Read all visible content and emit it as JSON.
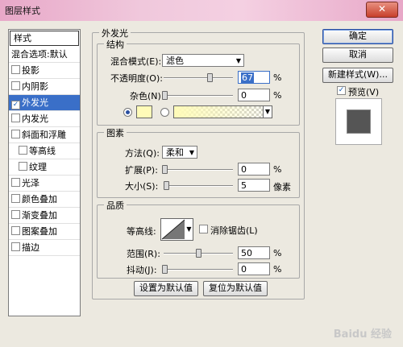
{
  "window": {
    "title": "图层样式",
    "close_glyph": "✕"
  },
  "style_list": {
    "header": "样式",
    "items": [
      {
        "label": "混合选项:默认",
        "checkbox": false,
        "checked": false,
        "selected": false,
        "indent": false
      },
      {
        "label": "投影",
        "checkbox": true,
        "checked": false,
        "selected": false,
        "indent": false
      },
      {
        "label": "内阴影",
        "checkbox": true,
        "checked": false,
        "selected": false,
        "indent": false
      },
      {
        "label": "外发光",
        "checkbox": true,
        "checked": true,
        "selected": true,
        "indent": false
      },
      {
        "label": "内发光",
        "checkbox": true,
        "checked": false,
        "selected": false,
        "indent": false
      },
      {
        "label": "斜面和浮雕",
        "checkbox": true,
        "checked": false,
        "selected": false,
        "indent": false
      },
      {
        "label": "等高线",
        "checkbox": true,
        "checked": false,
        "selected": false,
        "indent": true
      },
      {
        "label": "纹理",
        "checkbox": true,
        "checked": false,
        "selected": false,
        "indent": true
      },
      {
        "label": "光泽",
        "checkbox": true,
        "checked": false,
        "selected": false,
        "indent": false
      },
      {
        "label": "颜色叠加",
        "checkbox": true,
        "checked": false,
        "selected": false,
        "indent": false
      },
      {
        "label": "渐变叠加",
        "checkbox": true,
        "checked": false,
        "selected": false,
        "indent": false
      },
      {
        "label": "图案叠加",
        "checkbox": true,
        "checked": false,
        "selected": false,
        "indent": false
      },
      {
        "label": "描边",
        "checkbox": true,
        "checked": false,
        "selected": false,
        "indent": false
      }
    ]
  },
  "outer_glow": {
    "title": "外发光",
    "structure": {
      "title": "结构",
      "blend_mode_label": "混合模式(E):",
      "blend_mode_value": "滤色",
      "opacity_label": "不透明度(O):",
      "opacity_value": "67",
      "opacity_unit": "%",
      "noise_label": "杂色(N):",
      "noise_value": "0",
      "noise_unit": "%",
      "glow_color": "#fffbb8"
    },
    "elements": {
      "title": "图素",
      "technique_label": "方法(Q):",
      "technique_value": "柔和",
      "spread_label": "扩展(P):",
      "spread_value": "0",
      "spread_unit": "%",
      "size_label": "大小(S):",
      "size_value": "5",
      "size_unit": "像素"
    },
    "quality": {
      "title": "品质",
      "contour_label": "等高线:",
      "antialias_label": "消除锯齿(L)",
      "range_label": "范围(R):",
      "range_value": "50",
      "range_unit": "%",
      "jitter_label": "抖动(J):",
      "jitter_value": "0",
      "jitter_unit": "%"
    },
    "make_default_button": "设置为默认值",
    "reset_default_button": "复位为默认值"
  },
  "right_panel": {
    "ok_button": "确定",
    "cancel_button": "取消",
    "new_style_button": "新建样式(W)...",
    "preview_label": "预览(V)",
    "preview_checked": true,
    "check_glyph": "✓",
    "dropdown_glyph": "▼"
  },
  "watermark": "Baidu 经验"
}
